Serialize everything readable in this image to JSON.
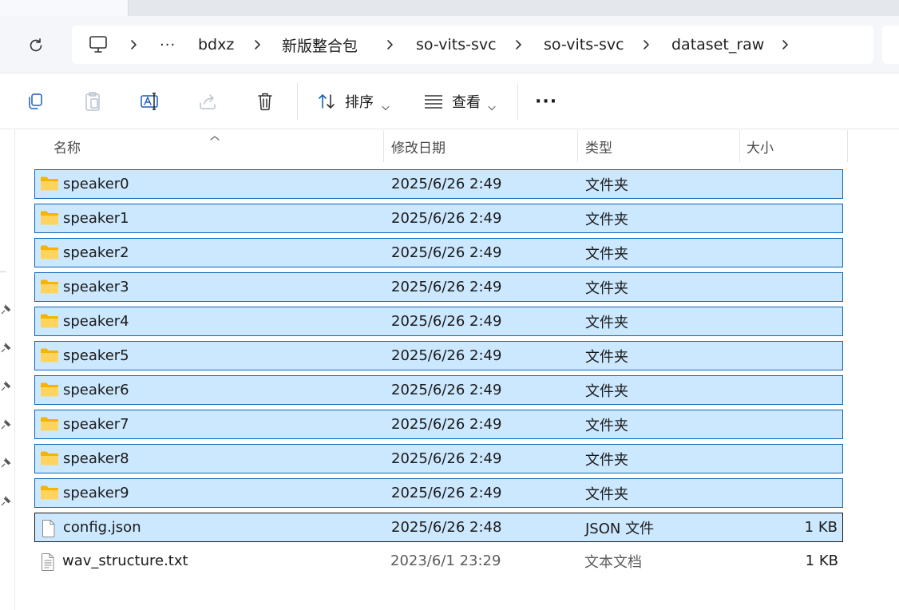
{
  "address": {
    "overflow_label": "···",
    "breadcrumb": [
      "bdxz",
      "新版整合包",
      "so-vits-svc",
      "so-vits-svc",
      "dataset_raw"
    ]
  },
  "toolbar": {
    "sort_label": "排序",
    "view_label": "查看",
    "more_label": "···"
  },
  "columns": {
    "name": "名称",
    "date": "修改日期",
    "type": "类型",
    "size": "大小"
  },
  "files": [
    {
      "name": "speaker0",
      "date": "2025/6/26 2:49",
      "type": "文件夹",
      "size": "",
      "kind": "folder",
      "selected": true
    },
    {
      "name": "speaker1",
      "date": "2025/6/26 2:49",
      "type": "文件夹",
      "size": "",
      "kind": "folder",
      "selected": true
    },
    {
      "name": "speaker2",
      "date": "2025/6/26 2:49",
      "type": "文件夹",
      "size": "",
      "kind": "folder",
      "selected": true
    },
    {
      "name": "speaker3",
      "date": "2025/6/26 2:49",
      "type": "文件夹",
      "size": "",
      "kind": "folder",
      "selected": true
    },
    {
      "name": "speaker4",
      "date": "2025/6/26 2:49",
      "type": "文件夹",
      "size": "",
      "kind": "folder",
      "selected": true
    },
    {
      "name": "speaker5",
      "date": "2025/6/26 2:49",
      "type": "文件夹",
      "size": "",
      "kind": "folder",
      "selected": true
    },
    {
      "name": "speaker6",
      "date": "2025/6/26 2:49",
      "type": "文件夹",
      "size": "",
      "kind": "folder",
      "selected": true
    },
    {
      "name": "speaker7",
      "date": "2025/6/26 2:49",
      "type": "文件夹",
      "size": "",
      "kind": "folder",
      "selected": true
    },
    {
      "name": "speaker8",
      "date": "2025/6/26 2:49",
      "type": "文件夹",
      "size": "",
      "kind": "folder",
      "selected": true
    },
    {
      "name": "speaker9",
      "date": "2025/6/26 2:49",
      "type": "文件夹",
      "size": "",
      "kind": "folder",
      "selected": true
    },
    {
      "name": "config.json",
      "date": "2025/6/26 2:48",
      "type": "JSON 文件",
      "size": "1 KB",
      "kind": "file",
      "selected": true,
      "focused": true
    },
    {
      "name": "wav_structure.txt",
      "date": "2023/6/1 23:29",
      "type": "文本文档",
      "size": "1 KB",
      "kind": "text",
      "selected": false
    }
  ],
  "colors": {
    "selection_fill": "#cce8ff",
    "selection_border": "#0b67b8",
    "folder_yellow": "#f8c53a"
  }
}
